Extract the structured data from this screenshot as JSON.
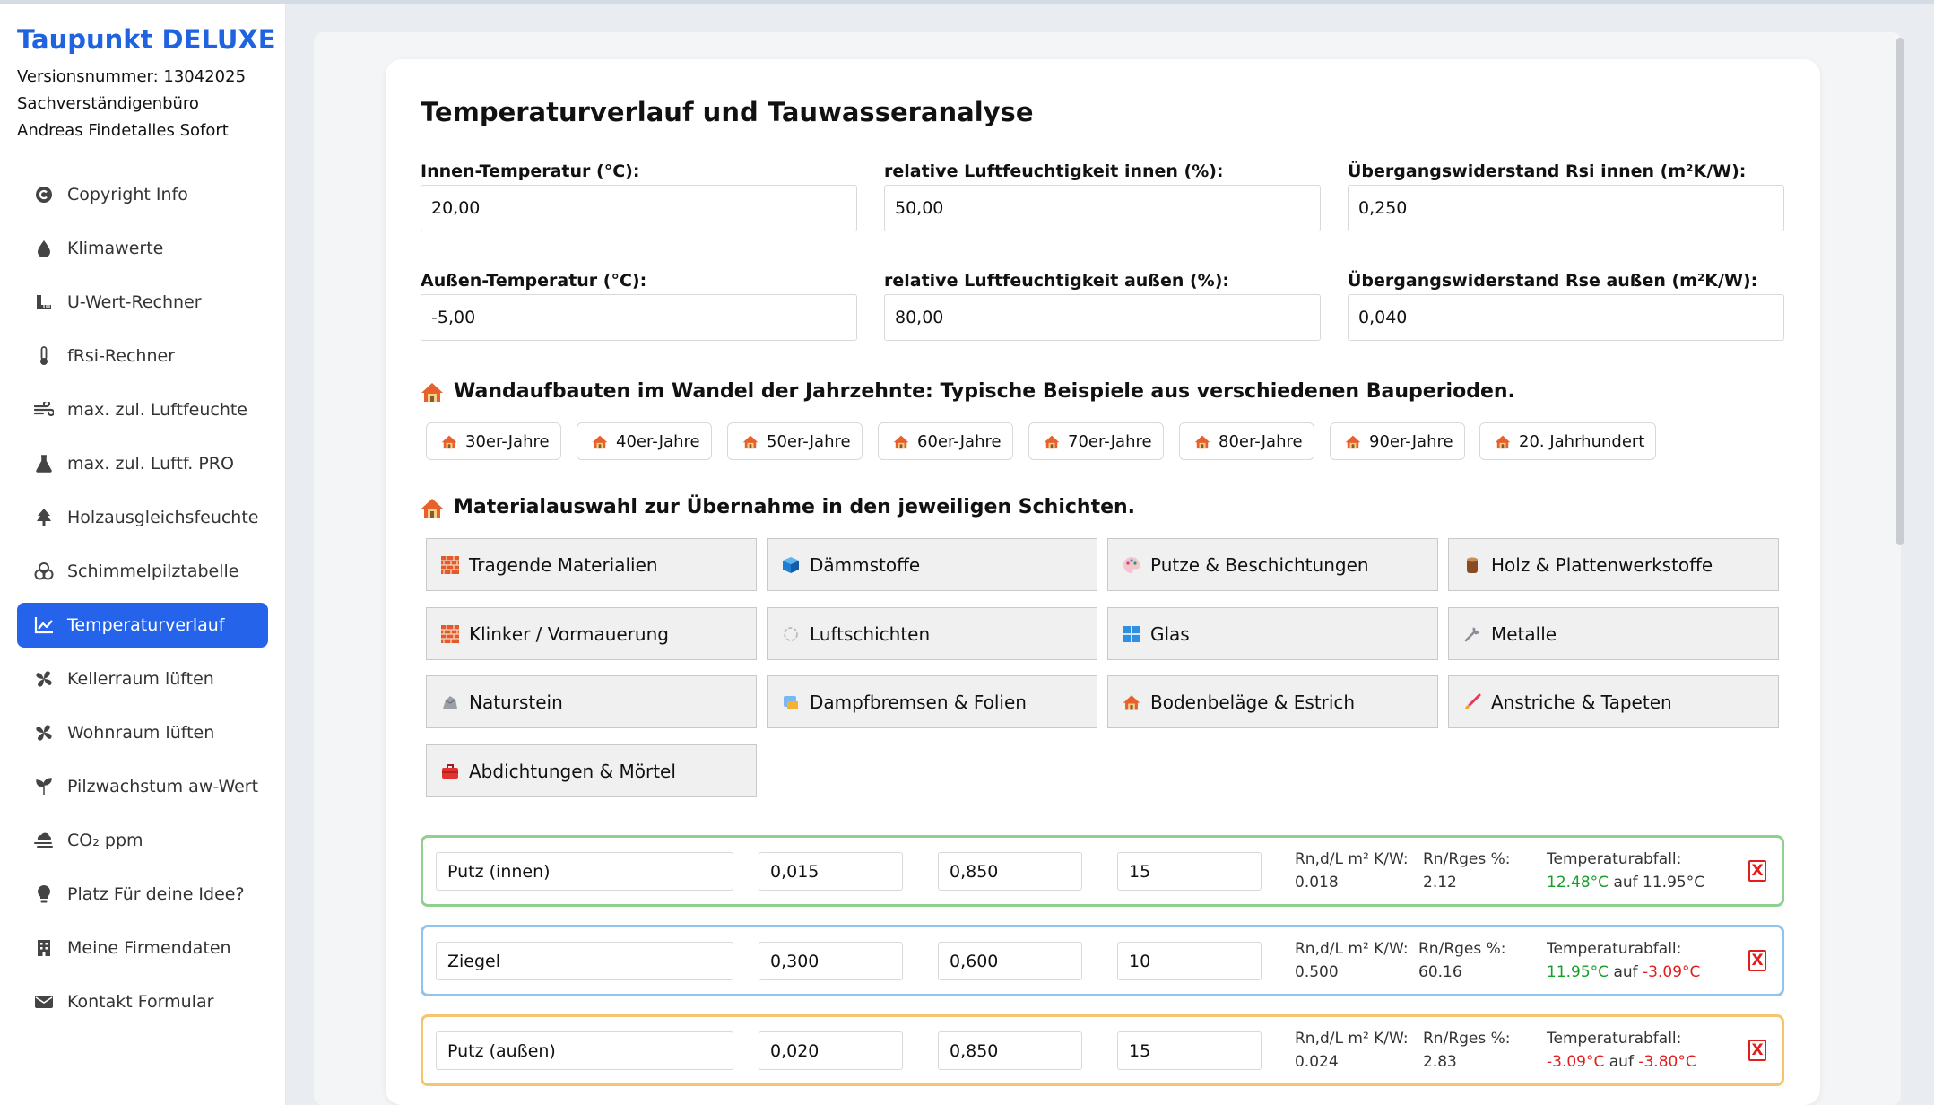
{
  "sidebar": {
    "brand": "Taupunkt DELUXE",
    "version": "Versionsnummer: 13042025",
    "office": "Sachverständigenbüro",
    "owner": "Andreas Findetalles Sofort",
    "items": [
      {
        "label": "Copyright Info",
        "icon": "copyright-icon"
      },
      {
        "label": "Klimawerte",
        "icon": "droplet-icon"
      },
      {
        "label": "U-Wert-Rechner",
        "icon": "ruler-icon"
      },
      {
        "label": "fRsi-Rechner",
        "icon": "thermometer-icon"
      },
      {
        "label": "max. zul. Luftfeuchte",
        "icon": "wind-icon"
      },
      {
        "label": "max. zul. Luftf. PRO",
        "icon": "flask-icon"
      },
      {
        "label": "Holzausgleichsfeuchte",
        "icon": "tree-icon"
      },
      {
        "label": "Schimmelpilztabelle",
        "icon": "biohazard-icon"
      },
      {
        "label": "Temperaturverlauf",
        "icon": "chart-line-icon"
      },
      {
        "label": "Kellerraum lüften",
        "icon": "fan-icon"
      },
      {
        "label": "Wohnraum lüften",
        "icon": "fan-icon"
      },
      {
        "label": "Pilzwachstum aw-Wert",
        "icon": "seedling-icon"
      },
      {
        "label": "CO₂ ppm",
        "icon": "smog-icon"
      },
      {
        "label": "Platz Für deine Idee?",
        "icon": "lightbulb-icon"
      },
      {
        "label": "Meine Firmendaten",
        "icon": "building-icon"
      },
      {
        "label": "Kontakt Formular",
        "icon": "envelope-icon"
      }
    ],
    "active_index": 8
  },
  "page": {
    "title": "Temperaturverlauf und Tauwasseranalyse"
  },
  "fields": {
    "t_in": {
      "label": "Innen-Temperatur (°C):",
      "value": "20,00"
    },
    "rh_in": {
      "label": "relative Luftfeuchtigkeit innen (%):",
      "value": "50,00"
    },
    "rsi": {
      "label": "Übergangswiderstand Rsi innen (m²K/W):",
      "value": "0,250"
    },
    "t_out": {
      "label": "Außen-Temperatur (°C):",
      "value": "-5,00"
    },
    "rh_out": {
      "label": "relative Luftfeuchtigkeit außen (%):",
      "value": "80,00"
    },
    "rse": {
      "label": "Übergangswiderstand Rse außen (m²K/W):",
      "value": "0,040"
    }
  },
  "eras": {
    "heading": "Wandaufbauten im Wandel der Jahrzehnte: Typische Beispiele aus verschiedenen Bauperioden.",
    "items": [
      "30er-Jahre",
      "40er-Jahre",
      "50er-Jahre",
      "60er-Jahre",
      "70er-Jahre",
      "80er-Jahre",
      "90er-Jahre",
      "20. Jahrhundert"
    ]
  },
  "materials": {
    "heading": "Materialauswahl zur Übernahme in den jeweiligen Schichten.",
    "items": [
      {
        "label": "Tragende Materialien",
        "icon": "brick-icon"
      },
      {
        "label": "Dämmstoffe",
        "icon": "cube-icon"
      },
      {
        "label": "Putze & Beschichtungen",
        "icon": "palette-icon"
      },
      {
        "label": "Holz & Plattenwerkstoffe",
        "icon": "wood-icon"
      },
      {
        "label": "Klinker / Vormauerung",
        "icon": "brick-icon"
      },
      {
        "label": "Luftschichten",
        "icon": "air-icon"
      },
      {
        "label": "Glas",
        "icon": "window-icon"
      },
      {
        "label": "Metalle",
        "icon": "wrench-icon"
      },
      {
        "label": "Naturstein",
        "icon": "rock-icon"
      },
      {
        "label": "Dampfbremsen & Folien",
        "icon": "foil-icon"
      },
      {
        "label": "Bodenbeläge & Estrich",
        "icon": "house-icon"
      },
      {
        "label": "Anstriche & Tapeten",
        "icon": "brush-icon"
      },
      {
        "label": "Abdichtungen & Mörtel",
        "icon": "toolbox-icon"
      }
    ]
  },
  "layers": [
    {
      "name": "Putz (innen)",
      "thickness": "0,015",
      "lambda": "0,850",
      "mu": "15",
      "r_label": "Rn,d/L m² K/W:",
      "r_value": "0.018",
      "pct_label": "Rn/Rges %:",
      "pct_value": "2.12",
      "drop_label": "Temperaturabfall:",
      "t_from": "12.48°C",
      "mid": " auf ",
      "t_to": "11.95°C",
      "from_color": "green",
      "to_color": "black",
      "border": "#8fd08f",
      "delete": "X"
    },
    {
      "name": "Ziegel",
      "thickness": "0,300",
      "lambda": "0,600",
      "mu": "10",
      "r_label": "Rn,d/L m² K/W:",
      "r_value": "0.500",
      "pct_label": "Rn/Rges %:",
      "pct_value": "60.16",
      "drop_label": "Temperaturabfall:",
      "t_from": "11.95°C",
      "mid": " auf ",
      "t_to": "-3.09°C",
      "from_color": "green",
      "to_color": "red",
      "border": "#8ec4ee",
      "delete": "X"
    },
    {
      "name": "Putz (außen)",
      "thickness": "0,020",
      "lambda": "0,850",
      "mu": "15",
      "r_label": "Rn,d/L m² K/W:",
      "r_value": "0.024",
      "pct_label": "Rn/Rges %:",
      "pct_value": "2.83",
      "drop_label": "Temperaturabfall:",
      "t_from": "-3.09°C",
      "mid": " auf ",
      "t_to": "-3.80°C",
      "from_color": "red",
      "to_color": "red",
      "border": "#f5c46f",
      "delete": "X"
    }
  ]
}
